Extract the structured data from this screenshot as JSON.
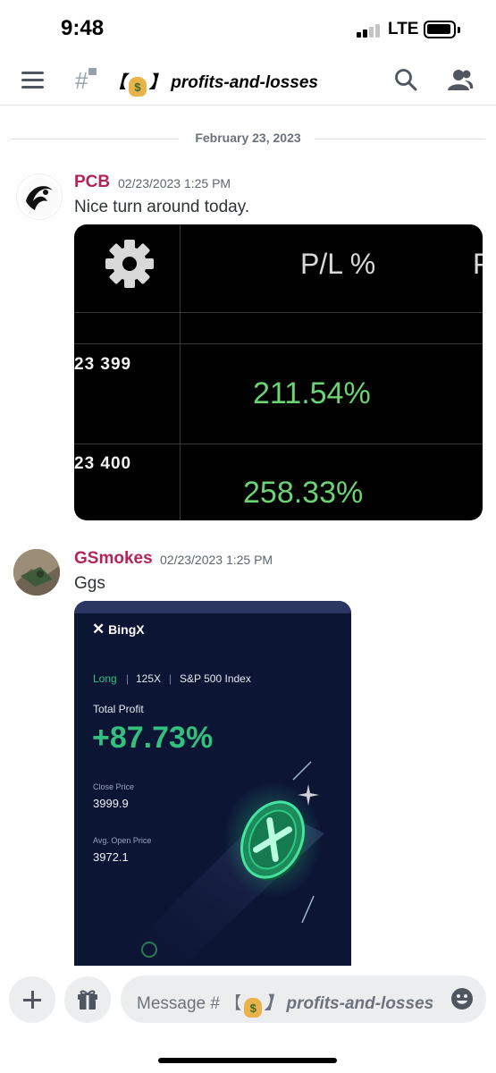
{
  "status_bar": {
    "time": "9:48",
    "network": "LTE"
  },
  "header": {
    "channel_prefix": "【",
    "channel_emoji": "$",
    "channel_suffix": "】 profits-and-losses"
  },
  "chat": {
    "date_divider": "February 23, 2023",
    "messages": [
      {
        "author": "PCB",
        "timestamp": "02/23/2023 1:25 PM",
        "text": "Nice turn around today.",
        "attachment": {
          "header": "P/L %",
          "header_cut": "P",
          "rows": [
            {
              "id": "23 399",
              "value": "211.54%"
            },
            {
              "id": "23 400",
              "value": "258.33%"
            }
          ]
        }
      },
      {
        "author": "GSmokes",
        "timestamp": "02/23/2023 1:25 PM",
        "text": "Ggs",
        "attachment": {
          "brand": "BingX",
          "direction": "Long",
          "leverage": "125X",
          "instrument": "S&P 500 Index",
          "total_profit_label": "Total Profit",
          "total_profit_value": "+87.73%",
          "close_price_label": "Close Price",
          "close_price_value": "3999.9",
          "avg_open_label": "Avg. Open Price",
          "avg_open_value": "3972.1"
        }
      }
    ]
  },
  "composer": {
    "placeholder_prefix": "Message # 【",
    "placeholder_emoji": "$",
    "placeholder_suffix": "】 profits-and-losses"
  },
  "colors": {
    "author": "#b1255b",
    "profit_green": "#6ad374",
    "bingx_bg": "#0d1535",
    "bingx_green": "#33c07f"
  },
  "icons": [
    "hamburger-icon",
    "hash-lock-icon",
    "money-bag-icon",
    "search-icon",
    "members-icon",
    "settings-gear-icon",
    "bingx-logo-icon",
    "coin-icon",
    "plus-icon",
    "gift-icon",
    "emoji-icon"
  ]
}
